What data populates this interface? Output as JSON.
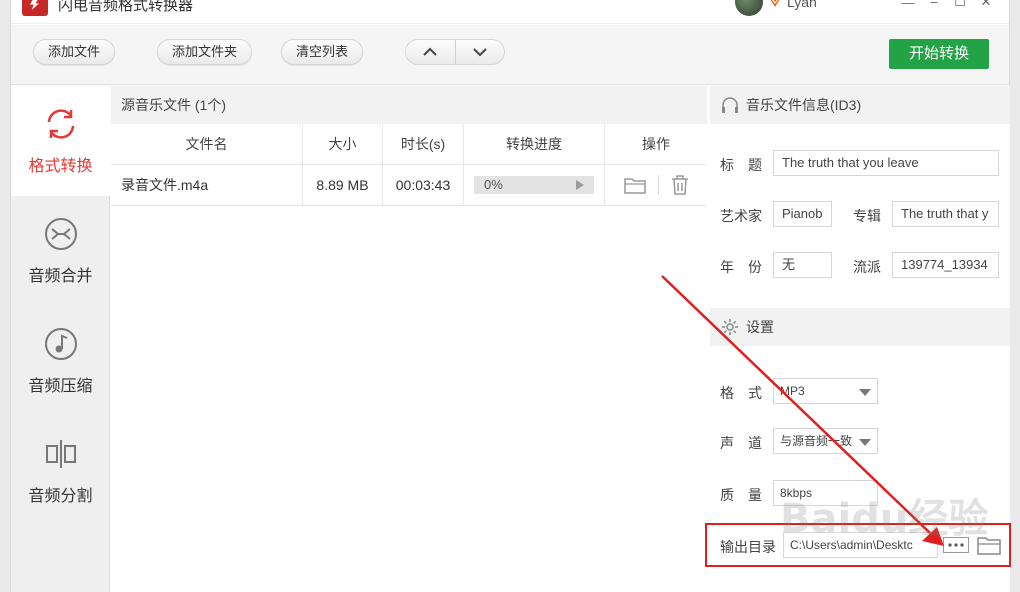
{
  "titlebar": {
    "title": "闪电音频格式转换器",
    "user_name": "Lyan",
    "buttons": [
      "minimize-icon",
      "restore-icon",
      "maximize-icon",
      "close-icon"
    ]
  },
  "toolbar": {
    "add_file": "添加文件",
    "add_folder": "添加文件夹",
    "clear_list": "清空列表",
    "move_up_icon": "chevron-up-icon",
    "move_down_icon": "chevron-down-icon",
    "start_convert": "开始转换"
  },
  "sidebar": {
    "items": [
      {
        "label": "格式转换",
        "icon": "refresh-icon",
        "active": true
      },
      {
        "label": "音频合并",
        "icon": "merge-icon",
        "active": false
      },
      {
        "label": "音频压缩",
        "icon": "music-note-icon",
        "active": false
      },
      {
        "label": "音频分割",
        "icon": "split-icon",
        "active": false
      }
    ]
  },
  "file_list": {
    "header": "源音乐文件 (1个)",
    "columns": [
      "文件名",
      "大小",
      "时长(s)",
      "转换进度",
      "操作"
    ],
    "rows": [
      {
        "name": "录音文件.m4a",
        "size": "8.89 MB",
        "duration": "00:03:43",
        "progress": "0%",
        "progress_value": 0
      }
    ]
  },
  "id3": {
    "header": "音乐文件信息(ID3)",
    "title_label": "标　题",
    "title_value": "The truth that you leave",
    "artist_label": "艺术家",
    "artist_value": "Pianob",
    "album_label": "专辑",
    "album_value": "The truth that y",
    "year_label": "年　份",
    "year_value": "无",
    "genre_label": "流派",
    "genre_value": "139774_13934"
  },
  "settings": {
    "header": "设置",
    "format_label": "格　式",
    "format_value": "MP3",
    "channel_label": "声　道",
    "channel_value": "与源音频一致",
    "quality_label": "质　量",
    "quality_value": "8kbps",
    "output_label": "输出目录",
    "output_value": "C:\\Users\\admin\\Desktc"
  },
  "watermark": "Baidu经验",
  "colors": {
    "accent_red": "#e53935",
    "start_green": "#22a446",
    "annotation_red": "#e02020"
  }
}
